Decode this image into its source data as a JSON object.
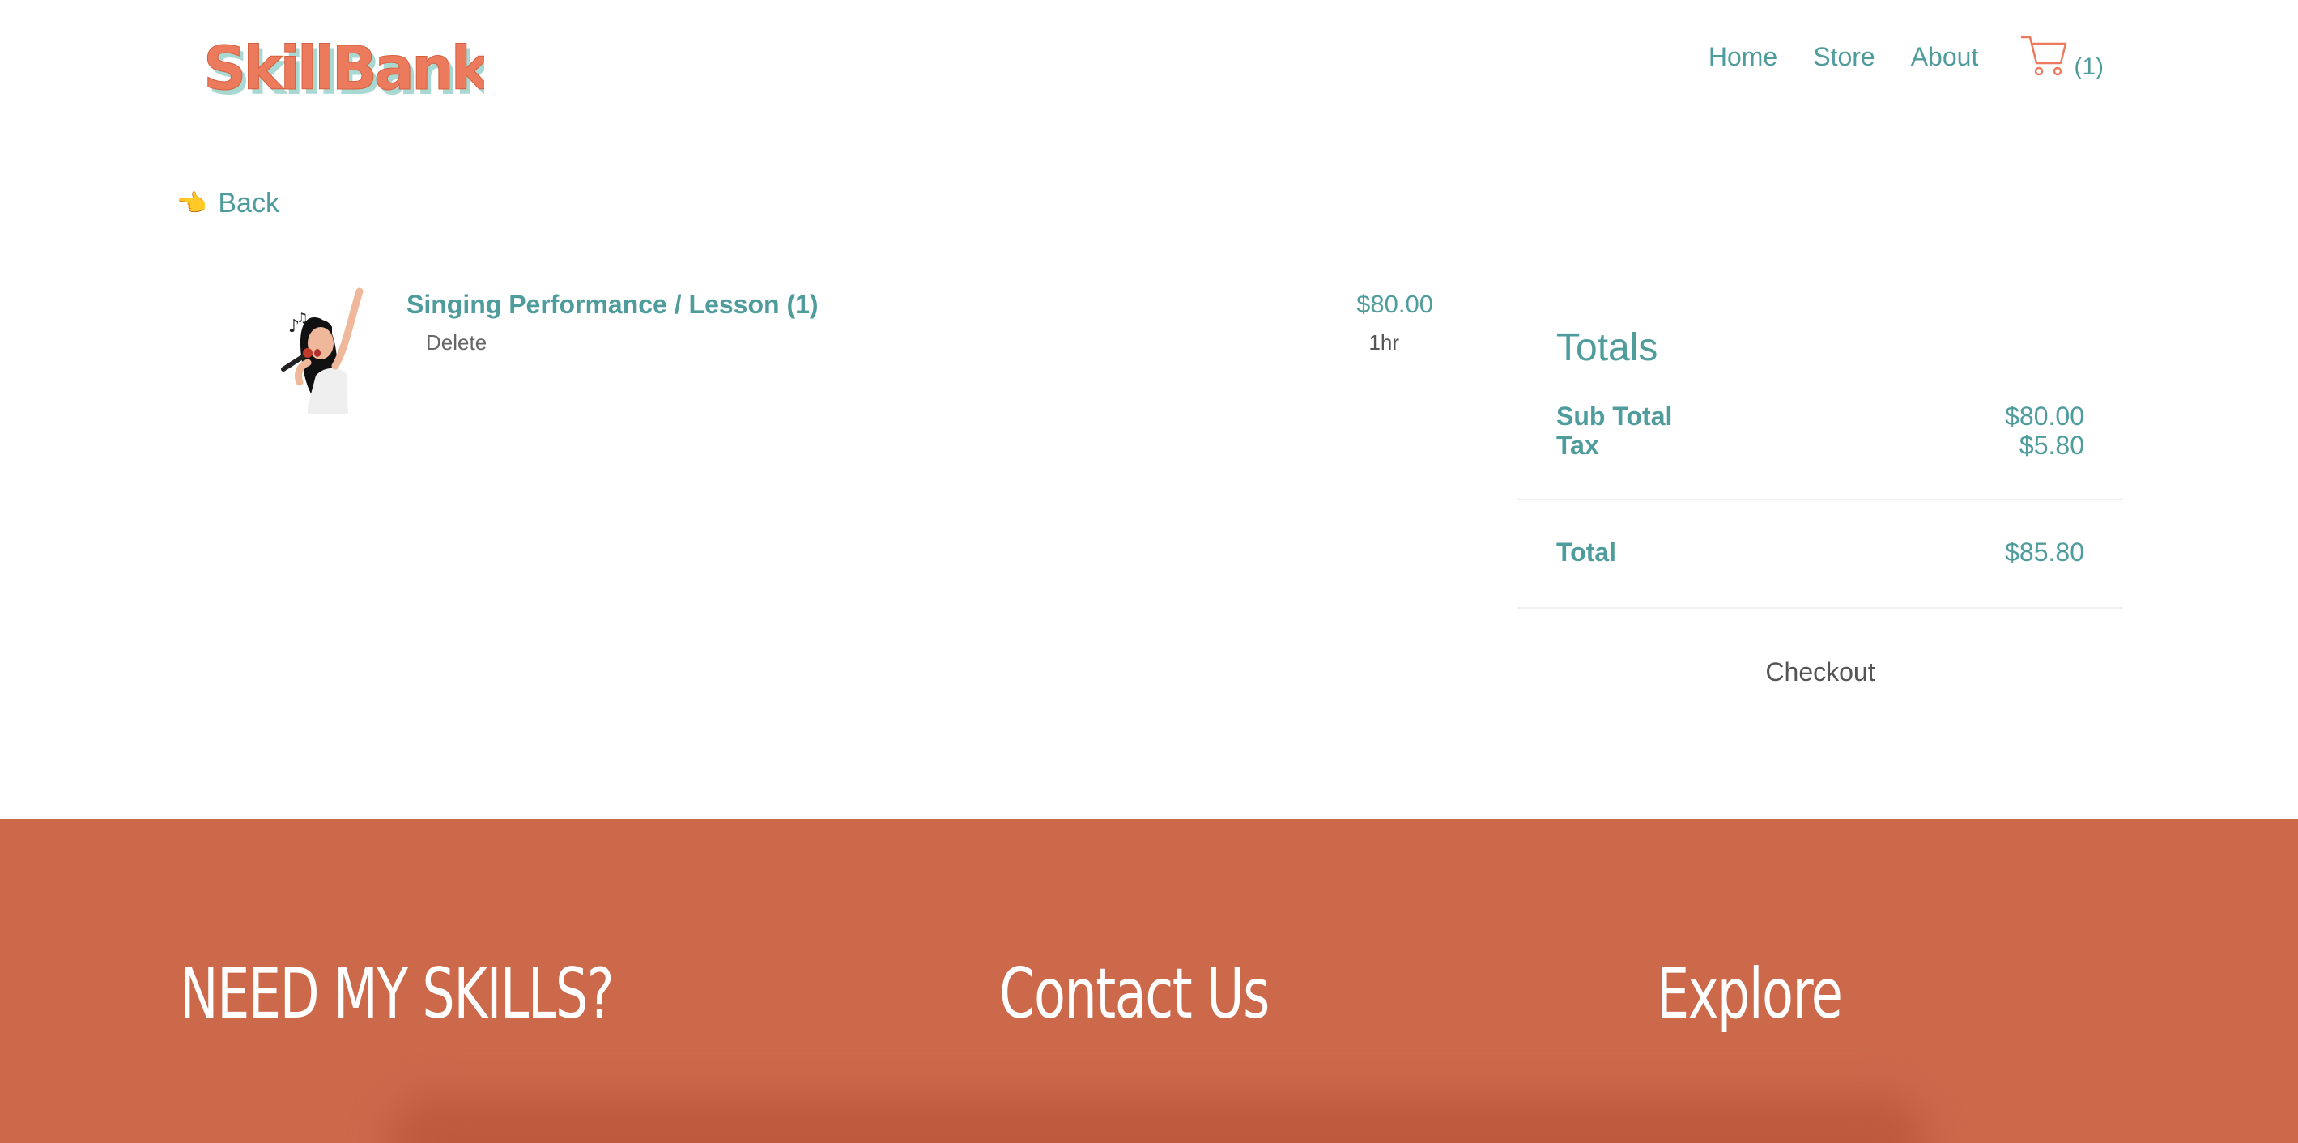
{
  "brand": {
    "logo_text": "SkillBank",
    "primary": "#ec7a5c",
    "accent": "#4f9c9c",
    "footer_bg": "#cd694b"
  },
  "nav": {
    "home": "Home",
    "store": "Store",
    "about": "About",
    "cart_icon": "shopping-cart-icon",
    "cart_count": "(1)"
  },
  "back": {
    "icon": "pointing-hand-icon",
    "glyph": "👈",
    "label": "Back"
  },
  "cart_item": {
    "title": "Singing Performance / Lesson (1)",
    "delete_label": "Delete",
    "price": "$80.00",
    "duration": "1hr"
  },
  "totals": {
    "title": "Totals",
    "subtotal_label": "Sub Total",
    "subtotal_value": "$80.00",
    "tax_label": "Tax",
    "tax_value": "$5.80",
    "total_label": "Total",
    "total_value": "$85.80",
    "checkout_label": "Checkout"
  },
  "footer": {
    "col1_title": "NEED MY SKILLS?",
    "col2_title": "Contact Us",
    "col3_title": "Explore"
  }
}
